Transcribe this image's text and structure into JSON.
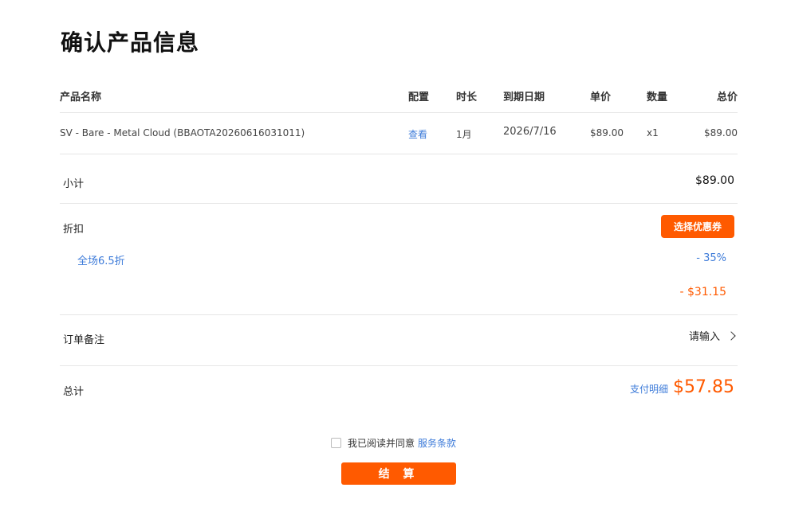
{
  "page": {
    "title": "确认产品信息"
  },
  "table": {
    "headers": {
      "name": "产品名称",
      "config": "配置",
      "duration": "时长",
      "expiry": "到期日期",
      "unit_price": "单价",
      "quantity": "数量",
      "total": "总价"
    },
    "rows": [
      {
        "name": "SV - Bare - Metal Cloud (BBAOTA20260616031011)",
        "config": "查看",
        "duration": "1月",
        "expiry": "2026/7/16",
        "unit_price": "$89.00",
        "quantity": "x1",
        "total": "$89.00"
      }
    ]
  },
  "subtotal": {
    "label": "小计",
    "value": "$89.00"
  },
  "discount": {
    "label": "折扣",
    "coupon_button": "选择优惠券",
    "name": "全场6.5折",
    "percent": "- 35%",
    "amount": "- $31.15"
  },
  "note": {
    "label": "订单备注",
    "placeholder": "请输入"
  },
  "total": {
    "label": "总计",
    "detail_link": "支付明细",
    "value": "$57.85"
  },
  "agreement": {
    "text": "我已阅读并同意",
    "link": "服务条款"
  },
  "checkout": {
    "label": "结 算"
  },
  "colors": {
    "accent": "#ff5a00",
    "link": "#3d7bd9"
  }
}
